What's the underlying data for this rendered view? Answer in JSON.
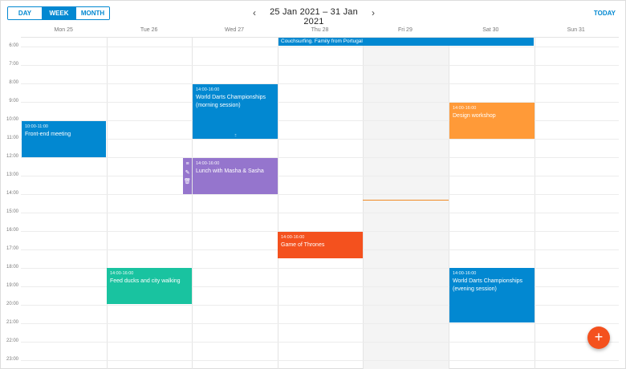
{
  "views": {
    "day": "DAY",
    "week": "WEEK",
    "month": "MONTH",
    "active": "week"
  },
  "nav": {
    "prev_icon": "‹",
    "next_icon": "›",
    "title": "25 Jan 2021 – 31 Jan 2021"
  },
  "today_label": "TODAY",
  "days": [
    "Mon 25",
    "Tue 26",
    "Wed 27",
    "Thu 28",
    "Fri 29",
    "Sat 30",
    "Sun 31"
  ],
  "hours": [
    "6:00",
    "7:00",
    "8:00",
    "9:00",
    "10:00",
    "11:00",
    "12:00",
    "13:00",
    "14:00",
    "15:00",
    "16:00",
    "17:00",
    "18:00",
    "19:00",
    "20:00",
    "21:00",
    "22:00",
    "23:00"
  ],
  "allday_event": "Couchsurfing. Family from Portugal",
  "events": {
    "darts_morning": {
      "time": "14:00-16:00",
      "title": "World Darts Championships (morning session)"
    },
    "frontend": {
      "time": "10:00-11:00",
      "title": "Front-end meeting"
    },
    "design": {
      "time": "14:00-16:00",
      "title": "Design workshop"
    },
    "lunch": {
      "time": "14:00-16:00",
      "title": "Lunch with Masha & Sasha"
    },
    "got": {
      "time": "14:00-16:00",
      "title": "Game of Thrones"
    },
    "ducks": {
      "time": "14:00-16:00",
      "title": "Feed ducks and city walking"
    },
    "darts_evening": {
      "time": "14:00-16:00",
      "title": "World Darts Championships (evening session)"
    }
  },
  "icons": {
    "tools": [
      "≡",
      "✎",
      "🗑"
    ],
    "handle": "::::",
    "fab": "+"
  },
  "colors": {
    "accent": "#0288d1",
    "purple": "#9575cd",
    "orange": "#ff9a38",
    "red": "#f4511e",
    "green": "#19c3a0",
    "now": "#f08a24"
  }
}
